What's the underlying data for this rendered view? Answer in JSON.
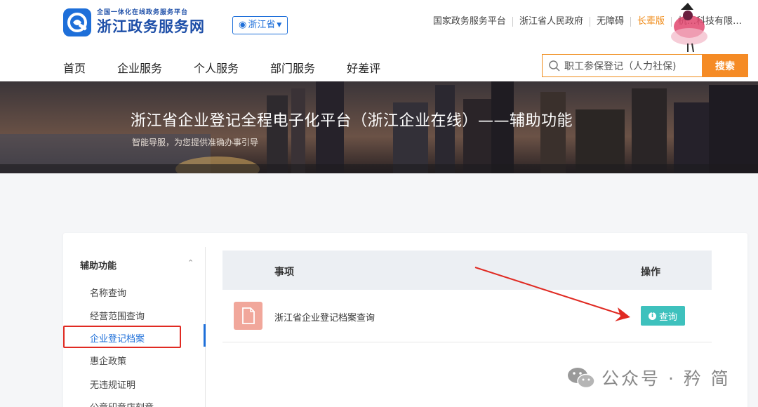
{
  "header": {
    "logo_sub": "全国一体化在线政务服务平台",
    "logo_main": "浙江政务服务网",
    "region": "浙江省",
    "top_links": [
      {
        "label": "国家政务服务平台",
        "highlight": false
      },
      {
        "label": "浙江省人民政府",
        "highlight": false
      },
      {
        "label": "无障碍",
        "highlight": false
      },
      {
        "label": "长辈版",
        "highlight": true
      },
      {
        "label": "杭…科技有限…",
        "highlight": false
      }
    ],
    "nav": [
      "首页",
      "企业服务",
      "个人服务",
      "部门服务",
      "好差评"
    ],
    "search_placeholder": "职工参保登记（人力社保)",
    "search_button": "搜索"
  },
  "banner": {
    "title": "浙江省企业登记全程电子化平台（浙江企业在线）——辅助功能",
    "subtitle": "智能导服，为您提供准确办事引导"
  },
  "sidebar": {
    "heading": "辅助功能",
    "items": [
      "名称查询",
      "经营范围查询",
      "企业登记档案",
      "惠企政策",
      "无违规证明",
      "公章印章店刻章"
    ],
    "active_index": 2
  },
  "table": {
    "col_item": "事项",
    "col_op": "操作",
    "rows": [
      {
        "name": "浙江省企业登记档案查询",
        "action": "查询"
      }
    ]
  },
  "watermark": "公众号 · 矜 简",
  "colors": {
    "brand_blue": "#1e6fd9",
    "accent_orange": "#f58b25",
    "query_teal": "#3ec1bd",
    "highlight_red": "#e02a22"
  }
}
